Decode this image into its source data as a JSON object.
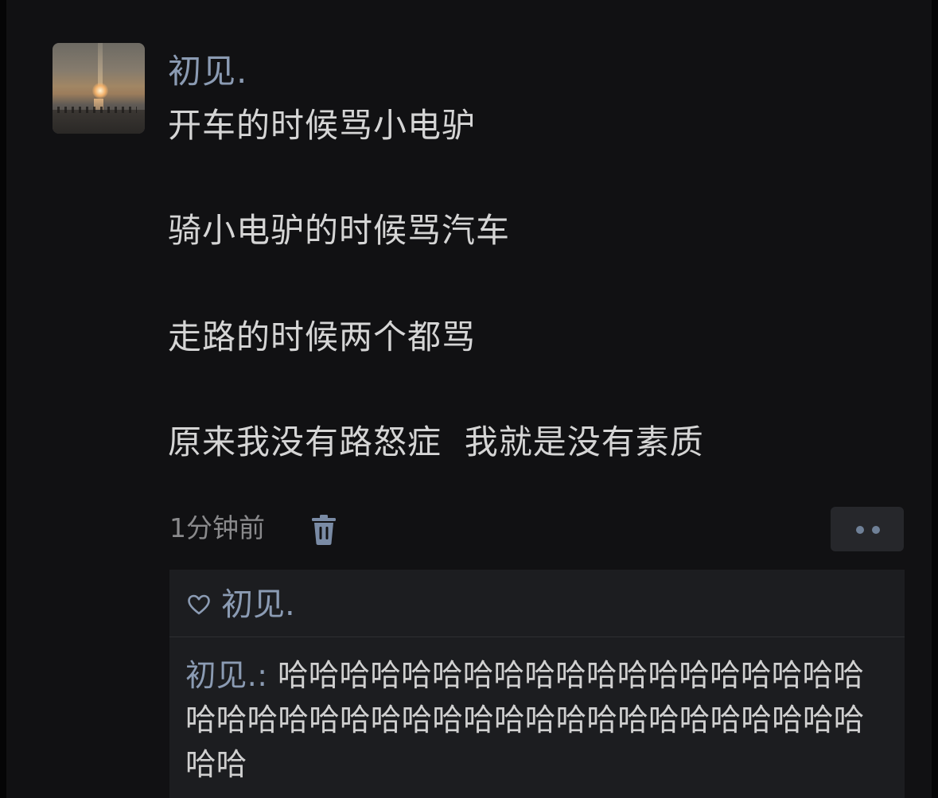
{
  "post": {
    "author": "初见.",
    "lines": [
      "开车的时候骂小电驴",
      "骑小电驴的时候骂汽车",
      "走路的时候两个都骂",
      "原来我没有路怒症  我就是没有素质"
    ],
    "timestamp": "1分钟前",
    "icons": {
      "delete": "trash-icon",
      "more": "more-dots-icon",
      "avatar": "sunset-photo"
    }
  },
  "reply_box": {
    "liked_by": "初见.",
    "comment": {
      "author": "初见.",
      "separator": ": ",
      "text": "哈哈哈哈哈哈哈哈哈哈哈哈哈哈哈哈哈哈哈哈哈哈哈哈哈哈哈哈哈哈哈哈哈哈哈哈哈哈哈哈哈哈哈"
    }
  },
  "colors": {
    "background": "#111113",
    "name_blue": "#8b9bb3",
    "text": "#d5d5d5",
    "muted": "#8a8a8c",
    "panel": "#1c1d20"
  }
}
